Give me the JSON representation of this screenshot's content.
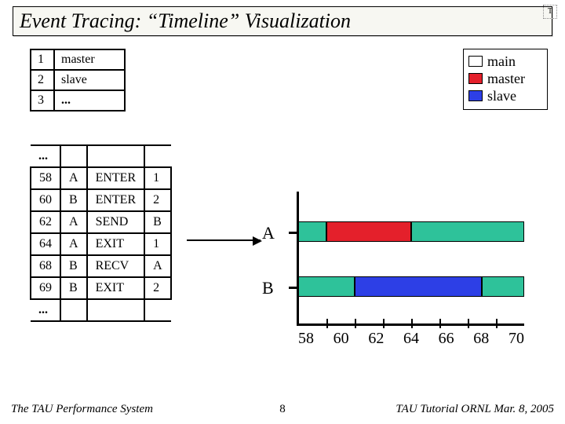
{
  "title": "Event Tracing: “Timeline” Visualization",
  "badge": "T",
  "name_table": {
    "rows": [
      {
        "idx": "1",
        "label": "master"
      },
      {
        "idx": "2",
        "label": "slave"
      },
      {
        "idx": "3",
        "label": "..."
      }
    ]
  },
  "legend": {
    "items": [
      {
        "label": "main",
        "color": "#2EC29A"
      },
      {
        "label": "master",
        "color": "#E4202B"
      },
      {
        "label": "slave",
        "color": "#2D3FE6"
      }
    ]
  },
  "trace_table": {
    "gap_top": "...",
    "rows": [
      {
        "t": "58",
        "p": "A",
        "ev": "ENTER",
        "arg": "1"
      },
      {
        "t": "60",
        "p": "B",
        "ev": "ENTER",
        "arg": "2"
      },
      {
        "t": "62",
        "p": "A",
        "ev": "SEND",
        "arg": "B"
      },
      {
        "t": "64",
        "p": "A",
        "ev": "EXIT",
        "arg": "1"
      },
      {
        "t": "68",
        "p": "B",
        "ev": "RECV",
        "arg": "A"
      },
      {
        "t": "69",
        "p": "B",
        "ev": "EXIT",
        "arg": "2"
      }
    ],
    "gap_bottom": "..."
  },
  "chart_data": {
    "type": "timeline",
    "xlabel": "",
    "ylabel": "",
    "x_ticks": [
      "58",
      "60",
      "62",
      "64",
      "66",
      "68",
      "70"
    ],
    "x_range": [
      58,
      70
    ],
    "rows": [
      {
        "name": "A",
        "segments": [
          {
            "from": 56,
            "to": 58,
            "color": "#2EC29A"
          },
          {
            "from": 58,
            "to": 64,
            "color": "#E4202B"
          },
          {
            "from": 64,
            "to": 72,
            "color": "#2EC29A"
          }
        ]
      },
      {
        "name": "B",
        "segments": [
          {
            "from": 56,
            "to": 60,
            "color": "#2EC29A"
          },
          {
            "from": 60,
            "to": 69,
            "color": "#2D3FE6"
          },
          {
            "from": 69,
            "to": 72,
            "color": "#2EC29A"
          }
        ]
      }
    ]
  },
  "footer": {
    "left": "The TAU Performance System",
    "center": "8",
    "right": "TAU Tutorial ORNL Mar. 8, 2005"
  }
}
